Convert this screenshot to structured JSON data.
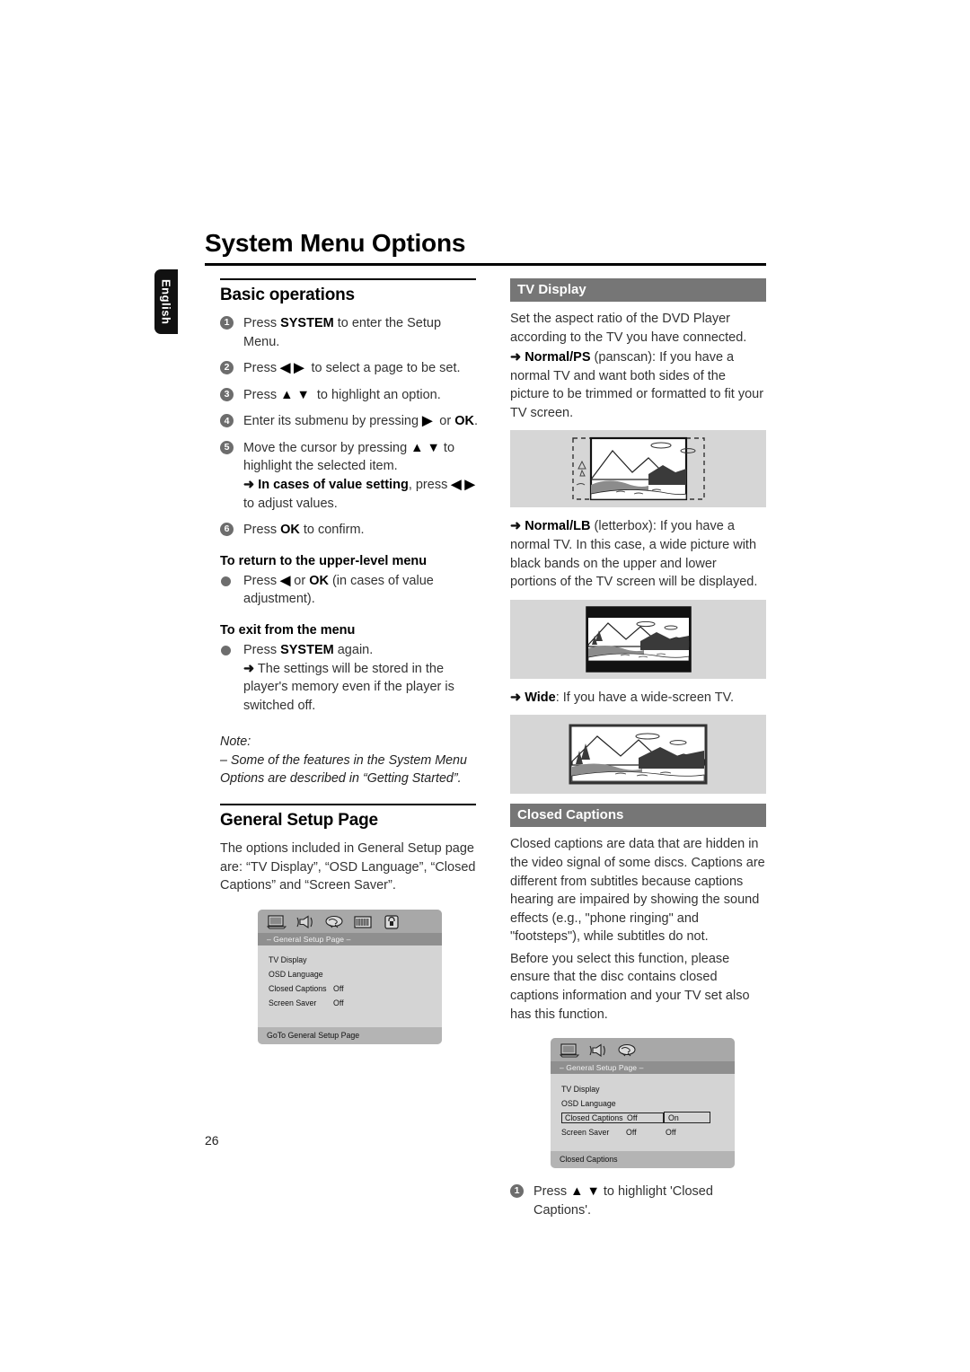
{
  "page": {
    "title": "System Menu Options",
    "language_tab": "English",
    "page_number": "26"
  },
  "left_column": {
    "basic_operations": {
      "heading": "Basic operations",
      "steps": [
        {
          "num": "1",
          "html": "Press <b>SYSTEM</b> to enter the Setup Menu.",
          "text": "Press SYSTEM to enter the Setup Menu."
        },
        {
          "num": "2",
          "html": "Press <b>◀ ▶</b>&nbsp; to select a page to be set.",
          "text": "Press ◀ ▶ to select a page to be set."
        },
        {
          "num": "3",
          "html": "Press <b>▲ ▼</b>&nbsp; to highlight an option.",
          "text": "Press ▲ ▼ to highlight an option."
        },
        {
          "num": "4",
          "html": "Enter its submenu by pressing <b>▶</b>&nbsp; or <b>OK</b>.",
          "text": "Enter its submenu by pressing ▶ or OK."
        },
        {
          "num": "5",
          "html": "Move the cursor by pressing <b>▲ ▼</b> to highlight the selected item.<br><span class=\"arrow\">➜</span> <b>In cases of value setting</b>, press <b>◀ ▶</b>&nbsp; to adjust values.",
          "text": "Move the cursor by pressing ▲ ▼ to highlight the selected item. ➜ In cases of value setting, press ◀ ▶ to adjust values."
        },
        {
          "num": "6",
          "html": "Press <b>OK</b> to confirm.",
          "text": "Press OK to confirm."
        }
      ]
    },
    "to_return": {
      "heading": "To return to the upper-level menu",
      "bullet_html": "Press <b>◀</b> or <b>OK</b> (in cases of value adjustment).",
      "bullet_text": "Press ◀ or OK (in cases of value adjustment)."
    },
    "to_exit": {
      "heading": "To exit from the menu",
      "bullet_html": "Press <b>SYSTEM</b> again.<br><span class=\"arrow\">➜</span> The settings will be stored in the player's memory even if the player is switched off.",
      "bullet_text": "Press SYSTEM again. ➜ The settings will be stored in the player's memory even if the player is switched off."
    },
    "note": {
      "label": "Note:",
      "text": "–  Some of the features in the System Menu Options are described in “Getting Started”."
    },
    "general_setup": {
      "heading": "General Setup Page",
      "intro": "The options included in General Setup page are: “TV Display”, “OSD Language”, “Closed Captions” and  “Screen Saver”."
    }
  },
  "osd_screen_1": {
    "icons": [
      "tv-display-icon",
      "audio-setup-icon",
      "preference-icon",
      "video-setup-icon",
      "password-lock-icon"
    ],
    "title": "– General Setup Page –",
    "rows": [
      {
        "label": "TV Display",
        "value": "",
        "value2": ""
      },
      {
        "label": "OSD Language",
        "value": "",
        "value2": ""
      },
      {
        "label": "Closed Captions",
        "value": "Off",
        "value2": ""
      },
      {
        "label": "Screen Saver",
        "value": "Off",
        "value2": ""
      }
    ],
    "footer": "GoTo General Setup Page"
  },
  "osd_screen_2": {
    "icons": [
      "tv-display-icon",
      "audio-setup-icon",
      "preference-icon"
    ],
    "title": "– General Setup Page –",
    "rows": [
      {
        "label": "TV Display",
        "value": "",
        "value2": "",
        "highlighted": false
      },
      {
        "label": "OSD Language",
        "value": "",
        "value2": "",
        "highlighted": false
      },
      {
        "label": "Closed Captions",
        "value": "Off",
        "value2": "On",
        "highlighted": true
      },
      {
        "label": "Screen Saver",
        "value": "Off",
        "value2": "Off",
        "highlighted": false
      }
    ],
    "footer": "Closed Captions"
  },
  "right_column": {
    "tv_display": {
      "heading": "TV Display",
      "intro": "Set the aspect ratio of the DVD Player according to the TV you have connected.",
      "normal_ps_html": "<span class=\"arrow\">➜</span> <b>Normal/PS</b> (panscan): If you have a normal TV and want both sides of the picture to be trimmed or formatted to fit your TV screen.",
      "normal_ps_text": "➜ Normal/PS (panscan): If you have a normal TV and want both sides of the picture to be trimmed or formatted to fit your TV screen.",
      "normal_lb_html": "<span class=\"arrow\">➜</span> <b>Normal/LB</b> (letterbox): If you have a normal TV. In this case, a wide picture with black bands on the upper and lower portions of the TV screen will be displayed.",
      "normal_lb_text": "➜ Normal/LB (letterbox): If you have a normal TV. In this case, a wide picture with black bands on the upper and lower portions of the TV screen will be displayed.",
      "wide_html": "<span class=\"arrow\">➜</span> <b>Wide</b>: If you have a wide-screen TV.",
      "wide_text": "➜ Wide: If you have a wide-screen TV."
    },
    "closed_captions": {
      "heading": "Closed Captions",
      "para1": "Closed captions are data that are hidden in the video signal of some discs. Captions are different from subtitles because captions hearing are impaired by showing the sound effects (e.g., \"phone ringing\" and \"footsteps\"), while subtitles do not.",
      "para2": "Before you select this function, please ensure that the disc contains closed captions information and your TV set also has this function.",
      "step": {
        "num": "1",
        "html": "Press <b>▲ ▼</b> to highlight 'Closed Captions'.",
        "text": "Press ▲ ▼ to highlight 'Closed Captions'."
      }
    }
  },
  "colors": {
    "section_header_bg": "#767676",
    "illustration_bg": "#d6d6d6",
    "osd_body_bg": "#d4d4d4",
    "osd_icons_bg": "#a8a8a8",
    "osd_title_bg": "#8f8f8f",
    "osd_footer_bg": "#b4b4b4",
    "bullet_gray": "#6d6d6d"
  }
}
